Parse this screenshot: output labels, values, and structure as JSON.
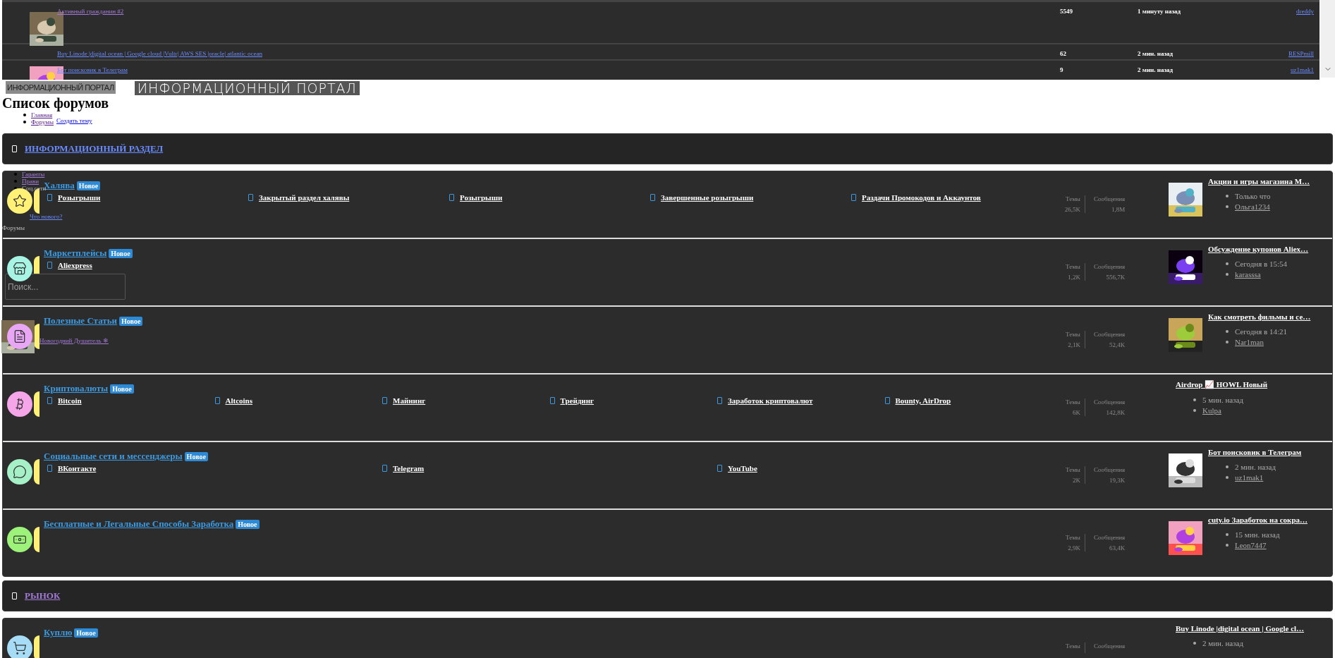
{
  "recent_threads": [
    {
      "title": "Активный гражданин #2",
      "visited": true,
      "avatar": true,
      "replies": "5549",
      "time": "1 минуту назад",
      "user": "dreddy"
    },
    {
      "title": "Buy Linode |digital ocean | Google cloud |Vultr| AWS SES |oracle| atlantic ocean",
      "visited": false,
      "avatar": false,
      "replies": "62",
      "time": "2 мин. назад",
      "user": "RESPmill"
    },
    {
      "title": "Бот поисковик в Телеграм",
      "visited": false,
      "avatar": true,
      "replies": "9",
      "time": "2 мин. назад",
      "user": "uz1mak1"
    }
  ],
  "logo": {
    "small_text": "ИНФОРМАЦИОННЫЙ ПОРТАЛ",
    "text": "ИНФОРМАЦИОННЫЙ ПОРТАЛ"
  },
  "page_title": "Список форумов",
  "breadcrumbs": [
    "Главная",
    "Форумы"
  ],
  "create_thread": "Создать тему",
  "nav_menu": {
    "items": [
      {
        "label": "Гаранты",
        "kind": "link"
      },
      {
        "label": "Прави",
        "kind": "link"
      },
      {
        "label": "Соц.сети",
        "kind": "text"
      }
    ],
    "whats_new": "Что нового?",
    "forums_label": "Форумы"
  },
  "search": {
    "placeholder": "Поиск..."
  },
  "user": {
    "name": "Новогодний Душитель",
    "badge": "❄"
  },
  "categories": [
    {
      "title": "ИНФОРМАЦИОННЫЙ РАЗДЕЛ",
      "visited": false,
      "forums": [
        {
          "title": "Халява",
          "badge": "Новое",
          "color": "#fff176",
          "subforums": [
            "Розыгрыши",
            "Закрытый раздел халявы",
            "Розыгрыши",
            "Завершенные розыгрыши",
            "Раздачи Промокодов и Аккаунтов"
          ],
          "stats": [
            {
              "label": "Темы",
              "value": "26,5K"
            },
            {
              "label": "Сообщения",
              "value": "1,8M"
            }
          ],
          "last_post": {
            "title": "Акции и игры магазина M…",
            "thumbnail": true,
            "time": "Только что",
            "user": "Ольга1234"
          }
        },
        {
          "title": "Маркетплейсы",
          "badge": "Новое",
          "color": "#a7f3e4",
          "subforums": [
            "Aliexpress"
          ],
          "stats": [
            {
              "label": "Темы",
              "value": "1,2K"
            },
            {
              "label": "Сообщения",
              "value": "556,7K"
            }
          ],
          "last_post": {
            "title": "Обсуждение купонов Aliex…",
            "thumbnail": true,
            "time": "Сегодня в 15:54",
            "user": "karasssa"
          }
        },
        {
          "title": "Полезные Статьи",
          "badge": "Новое",
          "color": "#e9a6f5",
          "stats": [
            {
              "label": "Темы",
              "value": "2,1K"
            },
            {
              "label": "Сообщения",
              "value": "52,4K"
            }
          ],
          "last_post": {
            "title": "Как смотреть фильмы и се…",
            "thumbnail": true,
            "time": "Сегодня в 14:21",
            "user": "Nar1man"
          }
        },
        {
          "title": "Криптовалюты",
          "badge": "Новое",
          "color": "#f5a6e9",
          "subforums": [
            "Bitcoin",
            "Altcoins",
            "Майнинг",
            "Трейдинг",
            "Заработок криптовалют",
            "Bounty, AirDrop"
          ],
          "stats": [
            {
              "label": "Темы",
              "value": "6K"
            },
            {
              "label": "Сообщения",
              "value": "142,8K"
            }
          ],
          "last_post": {
            "title": "Airdrop 📈 HOWL Новый",
            "thumbnail": false,
            "time": "5 мин. назад",
            "user": "Kulpa"
          }
        },
        {
          "title": "Социальные сети и мессенджеры",
          "badge": "Новое",
          "color": "#a6f0c8",
          "subforums": [
            "ВКонтакте",
            "Telegram",
            "YouTube"
          ],
          "stats": [
            {
              "label": "Темы",
              "value": "2K"
            },
            {
              "label": "Сообщения",
              "value": "19,3K"
            }
          ],
          "last_post": {
            "title": "Бот поисковик в Телеграм",
            "thumbnail": true,
            "time": "2 мин. назад",
            "user": "uz1mak1"
          }
        },
        {
          "title": "Бесплатные и Легальные Способы Заработка",
          "badge": "Новое",
          "color": "#9df27a",
          "stats": [
            {
              "label": "Темы",
              "value": "2,9K"
            },
            {
              "label": "Сообщения",
              "value": "63,4K"
            }
          ],
          "last_post": {
            "title": "cuty.io Заработок на сокра…",
            "thumbnail": true,
            "time": "15 мин. назад",
            "user": "Leon7447"
          }
        }
      ]
    },
    {
      "title": "РЫНОК",
      "visited": true,
      "forums": [
        {
          "title": "Куплю",
          "badge": "Новое",
          "color": "#a6dcf5",
          "stats": [
            {
              "label": "Темы"
            },
            {
              "label": "Сообщения"
            }
          ],
          "last_post": {
            "title": "Buy Linode |digital ocean | Google cl…",
            "thumbnail": false,
            "time": "2 мин. назад"
          }
        }
      ]
    }
  ]
}
